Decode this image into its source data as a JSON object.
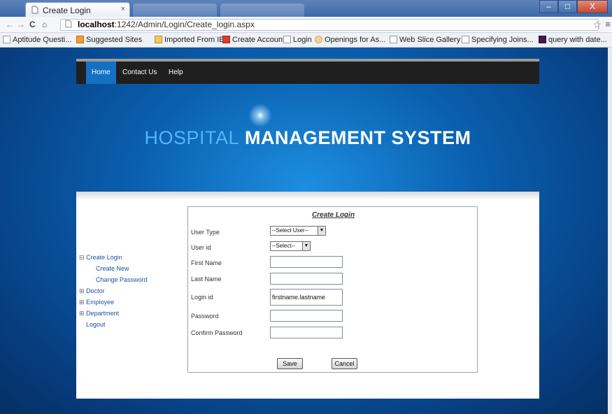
{
  "browser": {
    "tab_title": "Create Login",
    "tab_close": "×",
    "nav_back": "←",
    "nav_forward": "→",
    "nav_reload": "C",
    "nav_home": "⌂",
    "url_host": "localhost",
    "url_rest": ":1242/Admin/Login/Create_login.aspx",
    "star": "☆",
    "menu": "≡",
    "window": {
      "minimize": "–",
      "maximize": "□",
      "close": "X"
    }
  },
  "bookmarks": [
    {
      "label": "Aptitude Questi...",
      "icon": "page-icon"
    },
    {
      "label": "Suggested Sites",
      "icon": "orange-icon"
    },
    {
      "label": "Imported From IE",
      "icon": "folder-icon"
    },
    {
      "label": "Create Account",
      "icon": "red-icon"
    },
    {
      "label": "Login",
      "icon": "page-icon"
    },
    {
      "label": "Openings for As...",
      "icon": "circle-icon"
    },
    {
      "label": "Web Slice Gallery",
      "icon": "page-icon"
    },
    {
      "label": "Specifying Joins...",
      "icon": "page-icon"
    },
    {
      "label": "query with date...",
      "icon": "dark-icon"
    }
  ],
  "site": {
    "nav": [
      "Home",
      "Contact Us",
      "Help"
    ],
    "banner_part1": "HOSPITAL",
    "banner_part2": "MANAGEMENT SYSTEM"
  },
  "sidenav": {
    "create_login": "Create Login",
    "create_new": "Create New",
    "change_password": "Change Password",
    "doctor": "Doctor",
    "employee": "Employee",
    "department": "Department",
    "logout": "Logout",
    "minus": "⊟",
    "plus": "⊞"
  },
  "form": {
    "title": "Create Login",
    "user_type_label": "User Type",
    "user_type_value": "--Select User--",
    "user_id_label": "User id",
    "user_id_value": "--Select--",
    "first_name_label": "First Name",
    "first_name_value": "",
    "last_name_label": "Last Name",
    "last_name_value": "",
    "login_id_label": "Login id",
    "login_id_value": "firstname.lastname",
    "password_label": "Password",
    "password_value": "",
    "confirm_password_label": "Confirm Password",
    "confirm_password_value": "",
    "save_label": "Save",
    "cancel_label": "Cancel",
    "dropdown_arrow": "▼"
  },
  "colors": {
    "nav_active": "#1570c4",
    "banner_light": "#54b6f4",
    "link": "#1d4fa5"
  }
}
